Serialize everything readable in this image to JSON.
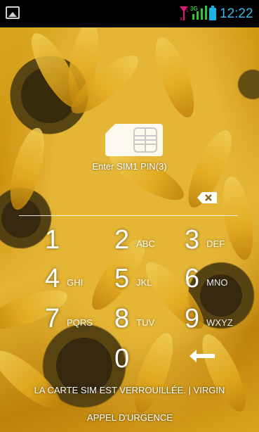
{
  "status_bar": {
    "time": "12:22",
    "sim1_icon": "sim-no-service-icon",
    "sim2_icon": "signal-icon",
    "battery_icon": "battery-icon",
    "notification_icon": "gallery-icon",
    "colors": {
      "clock": "#39b7ea",
      "sim1": "#e2167a",
      "sim2": "#34c33b"
    }
  },
  "lock": {
    "sim_icon": "sim-card-icon",
    "prompt": "Enter SIM1 PIN(3)",
    "backspace_icon": "backspace-icon",
    "enter_icon": "enter-arrow-icon"
  },
  "keypad": {
    "keys": [
      {
        "digit": "1",
        "letters": ""
      },
      {
        "digit": "2",
        "letters": "ABC"
      },
      {
        "digit": "3",
        "letters": "DEF"
      },
      {
        "digit": "4",
        "letters": "GHI"
      },
      {
        "digit": "5",
        "letters": "JKL"
      },
      {
        "digit": "6",
        "letters": "MNO"
      },
      {
        "digit": "7",
        "letters": "PQRS"
      },
      {
        "digit": "8",
        "letters": "TUV"
      },
      {
        "digit": "9",
        "letters": "WXYZ"
      },
      {
        "digit": "0",
        "letters": ""
      }
    ]
  },
  "footer": {
    "carrier_text": "LA CARTE SIM EST VERROUILLÉE. | VIRGIN",
    "emergency_label": "APPEL D'URGENCE"
  }
}
